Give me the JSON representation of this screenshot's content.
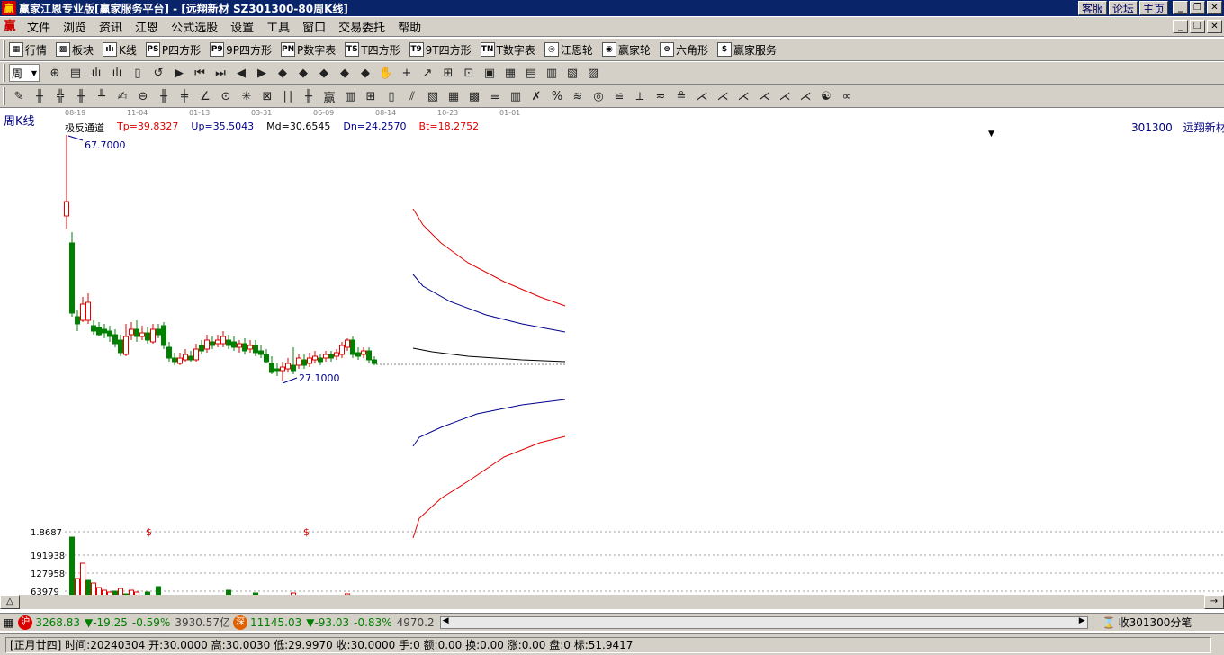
{
  "window": {
    "title": "赢家江恩专业版[赢家服务平台] - [远翔新材  SZ301300-80周K线]",
    "links": [
      "客服",
      "论坛",
      "主页"
    ],
    "logo_char": "赢"
  },
  "menu": {
    "items": [
      "文件",
      "浏览",
      "资讯",
      "江恩",
      "公式选股",
      "设置",
      "工具",
      "窗口",
      "交易委托",
      "帮助"
    ]
  },
  "toolbar1": {
    "items": [
      {
        "icon": "grid-icon",
        "glyph": "▦",
        "label": "行情"
      },
      {
        "icon": "block-icon",
        "glyph": "▩",
        "label": "板块"
      },
      {
        "icon": "kline-icon",
        "glyph": "ılı",
        "label": "K线"
      },
      {
        "icon": "ps-icon",
        "glyph": "PS",
        "label": "P四方形"
      },
      {
        "icon": "p9-icon",
        "glyph": "P9",
        "label": "9P四方形"
      },
      {
        "icon": "pn-icon",
        "glyph": "PN",
        "label": "P数字表"
      },
      {
        "icon": "ts-icon",
        "glyph": "TS",
        "label": "T四方形"
      },
      {
        "icon": "t9-icon",
        "glyph": "T9",
        "label": "9T四方形"
      },
      {
        "icon": "tn-icon",
        "glyph": "TN",
        "label": "T数字表"
      },
      {
        "icon": "gann-wheel-icon",
        "glyph": "◎",
        "label": "江恩轮"
      },
      {
        "icon": "winner-wheel-icon",
        "glyph": "◉",
        "label": "赢家轮"
      },
      {
        "icon": "hexagon-icon",
        "glyph": "⊛",
        "label": "六角形"
      },
      {
        "icon": "dollar-icon",
        "glyph": "$",
        "label": "赢家服务"
      }
    ]
  },
  "toolbar2": {
    "period": "周",
    "icons": [
      "⊕",
      "▤",
      "ılı",
      "ılı",
      "▯",
      "↺",
      "▶",
      "⏮",
      "⏭",
      "◀",
      "▶",
      "◆",
      "◆",
      "◆",
      "◆",
      "◆",
      "✋",
      "+",
      "↗",
      "⊞",
      "⊡",
      "▣",
      "▦",
      "▤",
      "▥",
      "▧",
      "▨"
    ]
  },
  "toolbar3": {
    "icons": [
      "✎",
      "╫",
      "╬",
      "╫",
      "╨",
      "✍",
      "⊖",
      "╫",
      "╪",
      "∠",
      "⊙",
      "✳",
      "⊠",
      "∣∣",
      "╫",
      "赢",
      "▥",
      "⊞",
      "▯",
      "⫽",
      "▧",
      "▦",
      "▩",
      "≡",
      "▥",
      "✗",
      "%",
      "≋",
      "◎",
      "≌",
      "⟂",
      "≂",
      "≗",
      "⋌",
      "⋌",
      "⋌",
      "⋌",
      "⋌",
      "⋌",
      "☯",
      "∞"
    ]
  },
  "chart": {
    "period_label": "周K线",
    "stock_code": "301300",
    "stock_name": "远翔新材",
    "dates": [
      "08-19",
      "11-04",
      "01-13",
      "03-31",
      "06-09",
      "08-14",
      "10-23",
      "01-01"
    ],
    "indicator": {
      "name": "极反通道",
      "tp": "Tp=39.8327",
      "up": "Up=35.5043",
      "md": "Md=30.6545",
      "dn": "Dn=24.2570",
      "bt": "Bt=18.2752"
    },
    "high_label": "67.7000",
    "low_label": "27.1000",
    "volume_labels": [
      "1.8687",
      "191938",
      "127958",
      "63979"
    ],
    "dollar_marks": [
      "$",
      "$"
    ],
    "colors": {
      "up": "#e00000",
      "down": "#008000",
      "channel_outer": "#e00000",
      "channel_inner": "#00008c",
      "channel_mid": "#000000"
    }
  },
  "quote": {
    "sh_badge": "沪",
    "sh_index": "3268.83",
    "sh_change": "▼-19.25",
    "sh_pct": "-0.59%",
    "sh_amount": "3930.57亿",
    "sz_badge": "深",
    "sz_index": "11145.03",
    "sz_change": "▼-93.03",
    "sz_pct": "-0.83%",
    "sz_amount": "4970.2",
    "right_text": "收301300分笔"
  },
  "status": {
    "text": "[正月廿四] 时间:20240304 开:30.0000 高:30.0030 低:29.9970 收:30.0000 手:0 额:0.00 换:0.00 涨:0.00 盘:0 标:51.9417"
  }
}
